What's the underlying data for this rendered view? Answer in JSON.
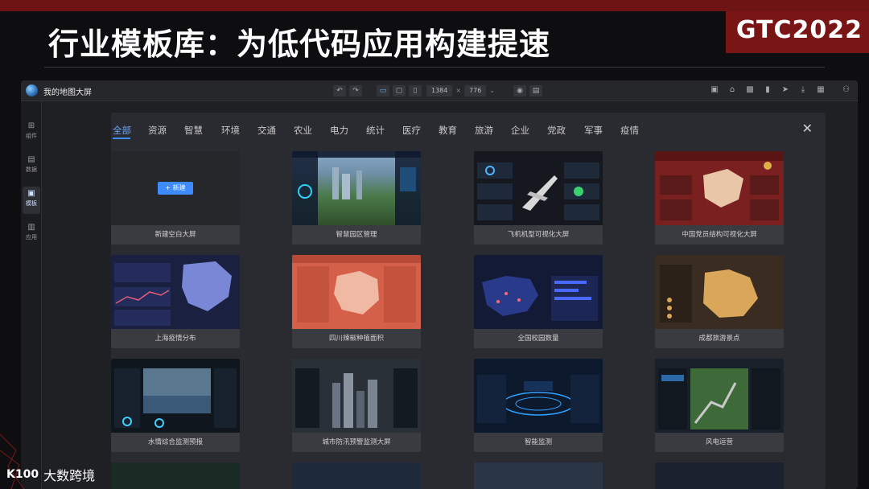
{
  "slide": {
    "title": "行业模板库：为低代码应用构建提速",
    "badge": "GTC2022",
    "brand": "大数跨境",
    "brand_logo": "K100"
  },
  "app": {
    "title": "我的地图大屏",
    "width_value": "1384",
    "height_value": "776",
    "size_sep": "×"
  },
  "sidebar": {
    "items": [
      {
        "label": "组件",
        "icon": "grid-icon"
      },
      {
        "label": "数据",
        "icon": "data-icon"
      },
      {
        "label": "模板",
        "icon": "template-icon"
      },
      {
        "label": "应用",
        "icon": "app-icon"
      }
    ]
  },
  "dialog": {
    "tabs": [
      "全部",
      "资源",
      "智慧",
      "环境",
      "交通",
      "农业",
      "电力",
      "统计",
      "医疗",
      "教育",
      "旅游",
      "企业",
      "党政",
      "军事",
      "疫情"
    ],
    "close": "✕",
    "new_button": "+ 新建",
    "cards": [
      {
        "caption": "新建空白大屏"
      },
      {
        "caption": "智慧园区管理"
      },
      {
        "caption": "飞机机型可视化大屏"
      },
      {
        "caption": "中国党员结构可视化大屏"
      },
      {
        "caption": "上海疫情分布"
      },
      {
        "caption": "四川辣椒种植面积"
      },
      {
        "caption": "全国校园数量"
      },
      {
        "caption": "成都旅游景点"
      },
      {
        "caption": "水情综合监测预报"
      },
      {
        "caption": "城市防汛预警监测大屏"
      },
      {
        "caption": "智能监测"
      },
      {
        "caption": "风电运营"
      }
    ]
  },
  "colors": {
    "accent": "#3d8bff",
    "banner": "#7a1515"
  }
}
